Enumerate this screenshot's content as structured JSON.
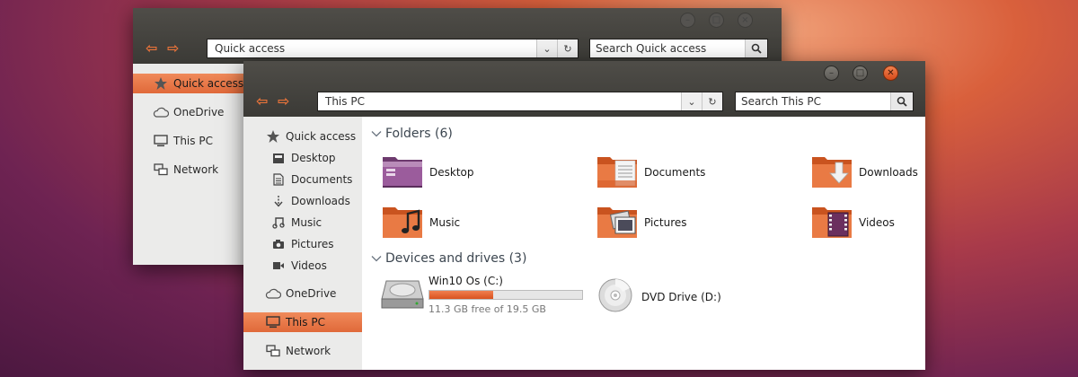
{
  "back_window": {
    "address": "Quick access",
    "search_placeholder": "Search Quick access",
    "nav": [
      {
        "label": "Quick access",
        "icon": "star-icon",
        "selected": true
      },
      {
        "label": "OneDrive",
        "icon": "cloud-icon"
      },
      {
        "label": "This PC",
        "icon": "computer-icon"
      },
      {
        "label": "Network",
        "icon": "network-icon"
      }
    ]
  },
  "front_window": {
    "address": "This PC",
    "search_placeholder": "Search This PC",
    "nav": [
      {
        "label": "Quick access",
        "icon": "star-icon"
      },
      {
        "label": "Desktop",
        "icon": "desktop-folder-icon"
      },
      {
        "label": "Documents",
        "icon": "document-icon"
      },
      {
        "label": "Downloads",
        "icon": "download-icon"
      },
      {
        "label": "Music",
        "icon": "music-icon"
      },
      {
        "label": "Pictures",
        "icon": "camera-icon"
      },
      {
        "label": "Videos",
        "icon": "video-icon"
      },
      {
        "label": "OneDrive",
        "icon": "cloud-icon"
      },
      {
        "label": "This PC",
        "icon": "computer-icon",
        "selected": true
      },
      {
        "label": "Network",
        "icon": "network-icon"
      }
    ],
    "folders_header": "Folders (6)",
    "folders": [
      {
        "label": "Desktop",
        "icon": "desktop-folder-icon"
      },
      {
        "label": "Documents",
        "icon": "documents-folder-icon"
      },
      {
        "label": "Downloads",
        "icon": "downloads-folder-icon"
      },
      {
        "label": "Music",
        "icon": "music-folder-icon"
      },
      {
        "label": "Pictures",
        "icon": "pictures-folder-icon"
      },
      {
        "label": "Videos",
        "icon": "videos-folder-icon"
      }
    ],
    "devices_header": "Devices and drives (3)",
    "drives": [
      {
        "label": "Win10 Os (C:)",
        "free_text": "11.3 GB free of 19.5 GB",
        "used_fraction": 0.42,
        "icon": "hard-drive-icon"
      },
      {
        "label": "DVD Drive (D:)",
        "icon": "dvd-icon"
      }
    ]
  },
  "colors": {
    "accent": "#e0693a",
    "titlebar": "#3b3a36",
    "sidebar_bg": "#ebebea",
    "close_button": "#e0561f"
  }
}
